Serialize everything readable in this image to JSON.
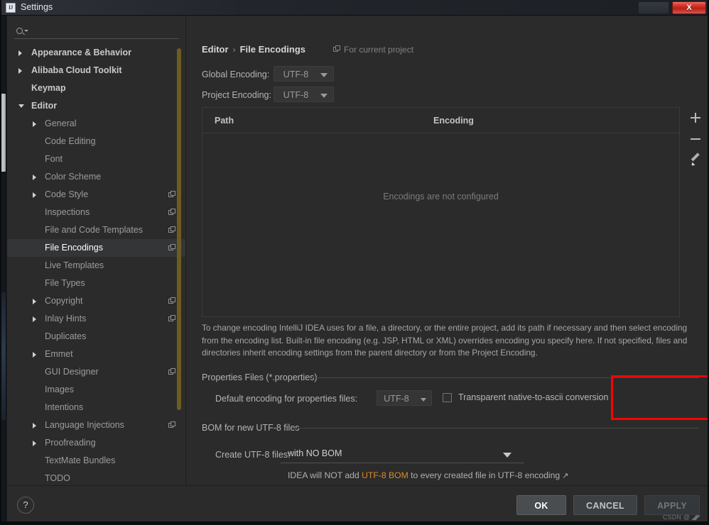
{
  "window": {
    "title": "Settings",
    "app_icon": "IJ",
    "close_label": "X"
  },
  "sidebar": {
    "search_placeholder": "",
    "search_value": "",
    "items": [
      {
        "label": "Appearance & Behavior",
        "level": 0,
        "arrow": "collapsed",
        "badge": false,
        "selected": false
      },
      {
        "label": "Alibaba Cloud Toolkit",
        "level": 0,
        "arrow": "collapsed",
        "badge": false,
        "selected": false
      },
      {
        "label": "Keymap",
        "level": 0,
        "arrow": "none",
        "badge": false,
        "selected": false
      },
      {
        "label": "Editor",
        "level": 0,
        "arrow": "expanded",
        "badge": false,
        "selected": false
      },
      {
        "label": "General",
        "level": 1,
        "arrow": "collapsed",
        "badge": false,
        "selected": false
      },
      {
        "label": "Code Editing",
        "level": 1,
        "arrow": "none",
        "badge": false,
        "selected": false
      },
      {
        "label": "Font",
        "level": 1,
        "arrow": "none",
        "badge": false,
        "selected": false
      },
      {
        "label": "Color Scheme",
        "level": 1,
        "arrow": "collapsed",
        "badge": false,
        "selected": false
      },
      {
        "label": "Code Style",
        "level": 1,
        "arrow": "collapsed",
        "badge": true,
        "selected": false
      },
      {
        "label": "Inspections",
        "level": 1,
        "arrow": "none",
        "badge": true,
        "selected": false
      },
      {
        "label": "File and Code Templates",
        "level": 1,
        "arrow": "none",
        "badge": true,
        "selected": false
      },
      {
        "label": "File Encodings",
        "level": 1,
        "arrow": "none",
        "badge": true,
        "selected": true
      },
      {
        "label": "Live Templates",
        "level": 1,
        "arrow": "none",
        "badge": false,
        "selected": false
      },
      {
        "label": "File Types",
        "level": 1,
        "arrow": "none",
        "badge": false,
        "selected": false
      },
      {
        "label": "Copyright",
        "level": 1,
        "arrow": "collapsed",
        "badge": true,
        "selected": false
      },
      {
        "label": "Inlay Hints",
        "level": 1,
        "arrow": "collapsed",
        "badge": true,
        "selected": false
      },
      {
        "label": "Duplicates",
        "level": 1,
        "arrow": "none",
        "badge": false,
        "selected": false
      },
      {
        "label": "Emmet",
        "level": 1,
        "arrow": "collapsed",
        "badge": false,
        "selected": false
      },
      {
        "label": "GUI Designer",
        "level": 1,
        "arrow": "none",
        "badge": true,
        "selected": false
      },
      {
        "label": "Images",
        "level": 1,
        "arrow": "none",
        "badge": false,
        "selected": false
      },
      {
        "label": "Intentions",
        "level": 1,
        "arrow": "none",
        "badge": false,
        "selected": false
      },
      {
        "label": "Language Injections",
        "level": 1,
        "arrow": "collapsed",
        "badge": true,
        "selected": false
      },
      {
        "label": "Proofreading",
        "level": 1,
        "arrow": "collapsed",
        "badge": false,
        "selected": false
      },
      {
        "label": "TextMate Bundles",
        "level": 1,
        "arrow": "none",
        "badge": false,
        "selected": false
      },
      {
        "label": "TODO",
        "level": 1,
        "arrow": "none",
        "badge": false,
        "selected": false
      }
    ]
  },
  "content": {
    "breadcrumb_parent": "Editor",
    "breadcrumb_separator": "›",
    "breadcrumb_current": "File Encodings",
    "scope_note": "For current project",
    "global_encoding_label": "Global Encoding:",
    "global_encoding_value": "UTF-8",
    "project_encoding_label": "Project Encoding:",
    "project_encoding_value": "UTF-8",
    "table": {
      "columns": [
        "Path",
        "Encoding"
      ],
      "rows": [],
      "empty_text": "Encodings are not configured"
    },
    "toolbar": {
      "add_label": "+",
      "remove_label": "−",
      "edit_label": "edit"
    },
    "help_text": "To change encoding IntelliJ IDEA uses for a file, a directory, or the entire project, add its path if necessary and then select encoding from the encoding list. Built-in file encoding (e.g. JSP, HTML or XML) overrides encoding you specify here. If not specified, files and directories inherit encoding settings from the parent directory or from the Project Encoding.",
    "properties_group": {
      "title": "Properties Files (*.properties)",
      "default_encoding_label": "Default encoding for properties files:",
      "default_encoding_value": "UTF-8",
      "checkbox_label": "Transparent native-to-ascii conversion",
      "checkbox_checked": false,
      "highlight_color": "#ff0000"
    },
    "bom_group": {
      "title": "BOM for new UTF-8 files",
      "create_label": "Create UTF-8 files:",
      "create_value": "with NO BOM",
      "note_prefix": "IDEA will NOT add ",
      "note_highlight": "UTF-8 BOM",
      "note_suffix": " to every created file in UTF-8 encoding",
      "note_link_arrow": "↗",
      "highlight_color": "#d98b28"
    }
  },
  "footer": {
    "help_label": "?",
    "ok_label": "OK",
    "cancel_label": "CANCEL",
    "apply_label": "APPLY",
    "watermark": "CSDN @"
  }
}
